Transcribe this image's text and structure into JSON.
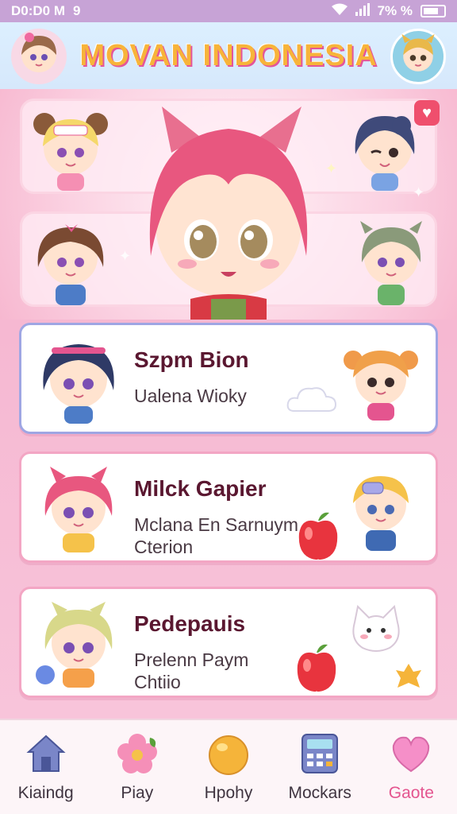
{
  "status_bar": {
    "time": "D0:D0 M",
    "notification_glyph": "9",
    "battery_text": "7% %"
  },
  "header": {
    "title": "MOVAN INDONESIA"
  },
  "list": [
    {
      "title": "Szpm Bion",
      "subtitle_lines": [
        "Ualena Wioky"
      ],
      "selected": true
    },
    {
      "title": "Milck Gapier",
      "subtitle_lines": [
        "Mclana En Sarnuym",
        "Cterion"
      ],
      "selected": false
    },
    {
      "title": "Pedepauis",
      "subtitle_lines": [
        "Prelenn Paym",
        "Chtiio"
      ],
      "selected": false
    }
  ],
  "nav": [
    {
      "label": "Kiaindg",
      "icon": "house-icon",
      "active": false
    },
    {
      "label": "Piay",
      "icon": "flower-icon",
      "active": false
    },
    {
      "label": "Hpohy",
      "icon": "ball-icon",
      "active": false
    },
    {
      "label": "Mockars",
      "icon": "calculator-icon",
      "active": false
    },
    {
      "label": "Gaote",
      "icon": "heart-icon",
      "active": true
    }
  ],
  "colors": {
    "accent_pink": "#e4558f",
    "title_yellow": "#f7b43a",
    "header_blue": "#dcefff",
    "card_border": "#f3a6c4",
    "selected_border": "#9fa6e3"
  }
}
